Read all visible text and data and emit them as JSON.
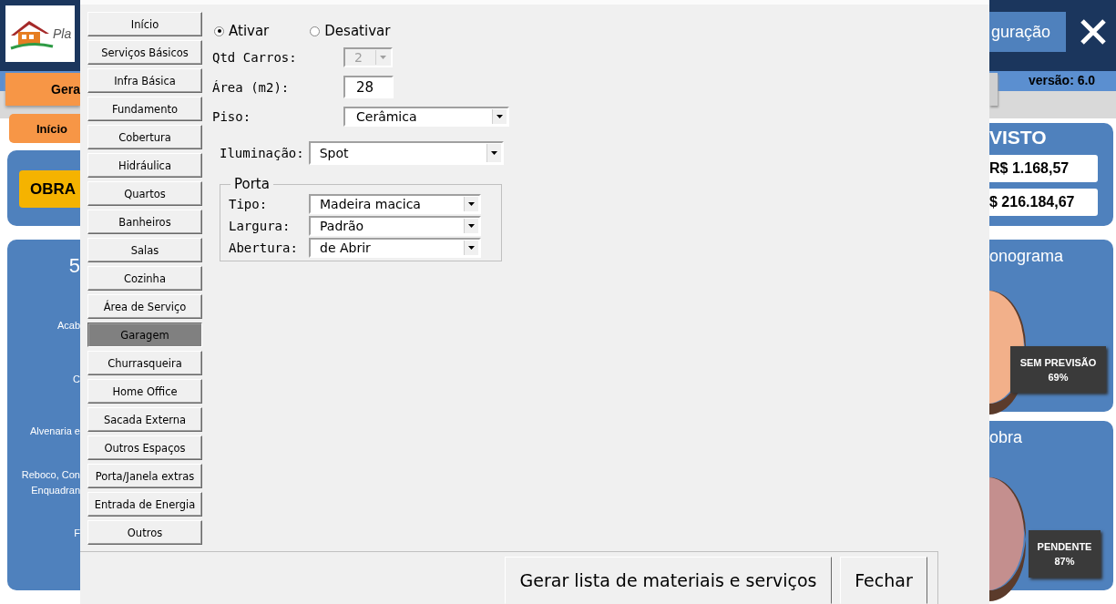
{
  "background": {
    "logo_text": "Pla",
    "tabs": [
      {
        "label": "Gera"
      },
      {
        "label": "Início"
      }
    ],
    "obra_button": "OBRA",
    "left_panel": {
      "title": "5",
      "items": [
        "Acab",
        "C",
        "Alvenaria e",
        "Reboco, Con",
        "Enquadran",
        "F"
      ]
    },
    "header_button": "guração",
    "version": "versão: 6.0",
    "summary": {
      "title": "VISTO",
      "values": [
        "R$ 1.168,57",
        "$ 216.184,67"
      ]
    },
    "charts": [
      {
        "title": "onograma",
        "label": "SEM PREVISÃO",
        "percent": "69%",
        "color": "#f2b08a"
      },
      {
        "title": "obra",
        "label": "PENDENTE",
        "percent": "87%",
        "color": "#c48f8e"
      }
    ]
  },
  "dialog": {
    "sections": [
      {
        "label": "Início",
        "selected": false
      },
      {
        "label": "Serviços Básicos",
        "selected": false
      },
      {
        "label": "Infra Básica",
        "selected": false
      },
      {
        "label": "Fundamento",
        "selected": false
      },
      {
        "label": "Cobertura",
        "selected": false
      },
      {
        "label": "Hidráulica",
        "selected": false
      },
      {
        "label": "Quartos",
        "selected": false
      },
      {
        "label": "Banheiros",
        "selected": false
      },
      {
        "label": "Salas",
        "selected": false
      },
      {
        "label": "Cozinha",
        "selected": false
      },
      {
        "label": "Área de Serviço",
        "selected": false
      },
      {
        "label": "Garagem",
        "selected": true
      },
      {
        "label": "Churrasqueira",
        "selected": false
      },
      {
        "label": "Home Office",
        "selected": false
      },
      {
        "label": "Sacada Externa",
        "selected": false
      },
      {
        "label": "Outros Espaços",
        "selected": false
      },
      {
        "label": "Porta/Janela extras",
        "selected": false
      },
      {
        "label": "Entrada de Energia",
        "selected": false
      },
      {
        "label": "Outros",
        "selected": false
      }
    ],
    "activation": [
      {
        "label": "Ativar",
        "selected": true
      },
      {
        "label": "Desativar",
        "selected": false
      }
    ],
    "fields": [
      {
        "kind": "combo",
        "label": "Qtd Carros:",
        "value": "2",
        "disabled": true
      },
      {
        "kind": "text",
        "label": "Área (m2):",
        "value": "28",
        "disabled": false
      },
      {
        "kind": "combo",
        "label": "Piso:",
        "value": "Cerâmica",
        "disabled": false
      }
    ],
    "lighting": {
      "label": "Iluminação:",
      "value": "Spot"
    },
    "porta": {
      "title": "Porta",
      "fields": [
        {
          "label": "Tipo:",
          "value": "Madeira macica"
        },
        {
          "label": "Largura:",
          "value": "Padrão"
        },
        {
          "label": "Abertura:",
          "value": "de Abrir"
        }
      ]
    },
    "buttons": [
      "Gerar lista de materiais e serviços",
      "Fechar"
    ]
  }
}
